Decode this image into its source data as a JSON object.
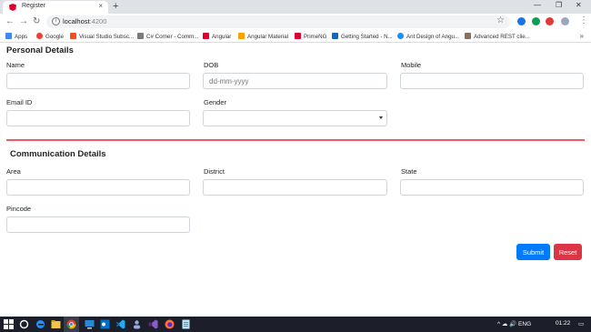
{
  "browser": {
    "tab_title": "Register",
    "tab_close": "×",
    "new_tab": "+",
    "url_host": "localhost",
    "url_port": ":4200",
    "window_min": "—",
    "window_restore": "❐",
    "window_close": "✕"
  },
  "bookmarks": [
    {
      "label": "Apps",
      "color": "#4285f4"
    },
    {
      "label": "Google",
      "color": "#ea4335"
    },
    {
      "label": "Visual Studio Subsc...",
      "color": "#f25022"
    },
    {
      "label": "C# Corner - Comm...",
      "color": "#7b7b7b"
    },
    {
      "label": "Angular",
      "color": "#dd0031"
    },
    {
      "label": "Angular Material",
      "color": "#ffa000"
    },
    {
      "label": "PrimeNG",
      "color": "#dd0031"
    },
    {
      "label": "Getting Started - N...",
      "color": "#1565c0"
    },
    {
      "label": "Ant Design of Angu...",
      "color": "#1890ff"
    },
    {
      "label": "Advanced REST clie...",
      "color": "#8d6e63"
    }
  ],
  "form": {
    "personal_heading": "Personal Details",
    "name_label": "Name",
    "dob_label": "DOB",
    "dob_placeholder": "dd-mm-yyyy",
    "mobile_label": "Mobile",
    "email_label": "Email ID",
    "gender_label": "Gender",
    "communication_heading": "Communication Details",
    "area_label": "Area",
    "district_label": "District",
    "state_label": "State",
    "pincode_label": "Pincode",
    "submit_label": "Submit",
    "reset_label": "Reset",
    "accent_submit": "#007bff",
    "accent_reset": "#dc3545",
    "divider_color": "#e95d63"
  },
  "taskbar": {
    "tray_text": "^ ☁ 🔊 ENG",
    "time": "01:22"
  }
}
